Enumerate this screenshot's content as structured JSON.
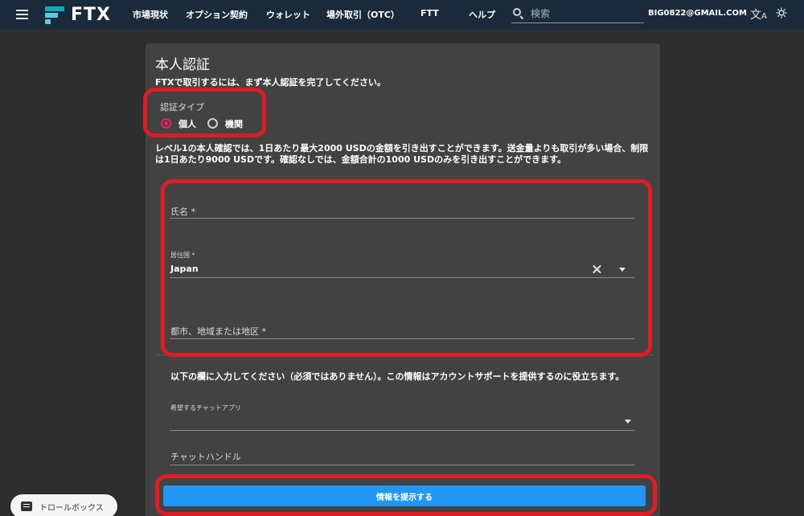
{
  "header": {
    "logo_text": "FTX",
    "nav": [
      "市場現状",
      "オプション契約",
      "ウォレット",
      "場外取引（OTC）",
      "FTT",
      "ヘルプ"
    ],
    "search_placeholder": "検索",
    "email": "BIG0822@GMAIL.COM",
    "icons": [
      "menu-icon",
      "search-icon",
      "translate-icon",
      "theme-icon"
    ]
  },
  "form": {
    "title": "本人認証",
    "subtitle": "FTXで取引するには、まず本人認証を完了してください。",
    "auth_type_label": "認証タイプ",
    "auth_type_options": [
      {
        "label": "個人",
        "selected": true
      },
      {
        "label": "機関",
        "selected": false
      }
    ],
    "info_text": "レベル1の本人確認では、1日あたり最大2000 USDの金額を引き出すことができます。送金量よりも取引が多い場合、制限は1日あたり9000 USDです。確認なしでは、金額合計の1000 USDのみを引き出すことができます。",
    "name_label": "氏名 *",
    "country_label": "居住国 *",
    "country_value": "Japan",
    "city_label": "都市、地域または地区 *",
    "optional_text": "以下の欄に入力してください（必須ではありません）。この情報はアカウントサポートを提供するのに役立ちます。",
    "chat_app_label": "希望するチャットアプリ",
    "chat_handle_label": "チャットハンドル",
    "submit_label": "情報を提示する"
  },
  "trollbox": {
    "label": "トロールボックス"
  },
  "colors": {
    "header_bg": "#1b2a3a",
    "page_bg": "#2e2e2e",
    "panel_bg": "#424242",
    "accent_radio": "#e91e63",
    "submit_bg": "#2196f3",
    "highlight": "#e01b24"
  }
}
